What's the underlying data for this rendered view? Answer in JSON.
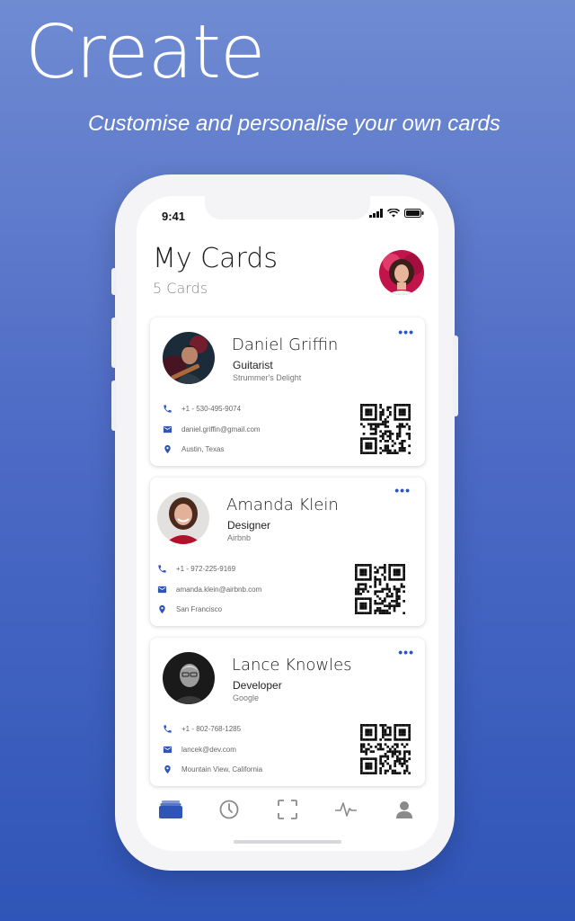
{
  "promo": {
    "headline": "Create",
    "subline": "Customise and personalise your own cards"
  },
  "status_bar": {
    "time": "9:41"
  },
  "header": {
    "title": "My Cards",
    "count": "5 Cards"
  },
  "cards": [
    {
      "name": "Daniel Griffin",
      "role": "Guitarist",
      "company": "Strummer's Delight",
      "phone": "+1 - 530-495-9074",
      "email": "daniel.griffin@gmail.com",
      "location": "Austin, Texas"
    },
    {
      "name": "Amanda Klein",
      "role": "Designer",
      "company": "Airbnb",
      "phone": "+1 - 972-225-9169",
      "email": "amanda.klein@airbnb.com",
      "location": "San Francisco"
    },
    {
      "name": "Lance Knowles",
      "role": "Developer",
      "company": "Google",
      "phone": "+1 - 802-768-1285",
      "email": "lancek@dev.com",
      "location": "Mountain View, California"
    }
  ],
  "tabbar": {
    "items": [
      "cards-icon",
      "history-icon",
      "scan-icon",
      "activity-icon",
      "profile-icon"
    ],
    "active": "cards-icon"
  },
  "colors": {
    "accent": "#2f55b8",
    "background_top": "#6f8bd2",
    "background_bottom": "#2f55b8"
  }
}
